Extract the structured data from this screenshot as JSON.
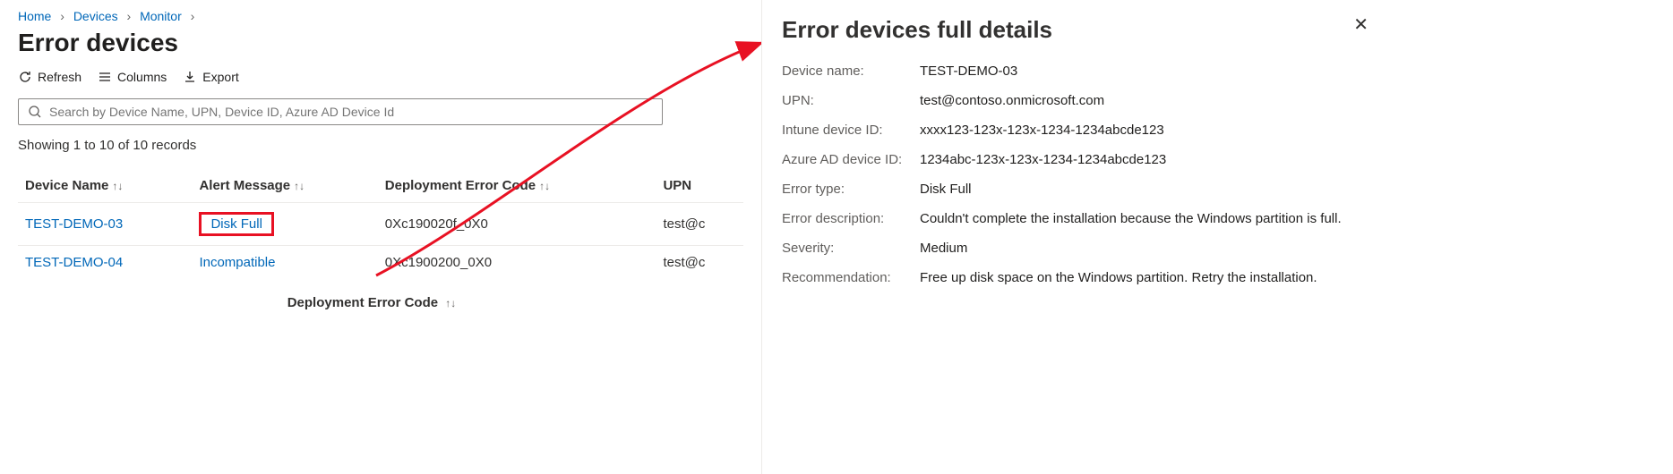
{
  "breadcrumb": {
    "home": "Home",
    "devices": "Devices",
    "monitor": "Monitor"
  },
  "page_title": "Error devices",
  "toolbar": {
    "refresh": "Refresh",
    "columns": "Columns",
    "export": "Export"
  },
  "search": {
    "placeholder": "Search by Device Name, UPN, Device ID, Azure AD Device Id"
  },
  "records_line": "Showing 1 to 10 of 10 records",
  "columns": {
    "device_name": "Device Name",
    "alert_message": "Alert Message",
    "deployment_error_code": "Deployment Error Code",
    "upn": "UPN"
  },
  "rows": [
    {
      "device_name": "TEST-DEMO-03",
      "alert_message": "Disk Full",
      "deployment_error_code": "0Xc190020f_0X0",
      "upn": "test@c"
    },
    {
      "device_name": "TEST-DEMO-04",
      "alert_message": "Incompatible",
      "deployment_error_code": "0Xc1900200_0X0",
      "upn": "test@c"
    }
  ],
  "footer_col_label": "Deployment Error Code",
  "flyout": {
    "title": "Error devices full details",
    "labels": {
      "device_name": "Device name:",
      "upn": "UPN:",
      "intune_id": "Intune device ID:",
      "aad_id": "Azure AD device ID:",
      "error_type": "Error type:",
      "error_description": "Error description:",
      "severity": "Severity:",
      "recommendation": "Recommendation:"
    },
    "values": {
      "device_name": "TEST-DEMO-03",
      "upn": "test@contoso.onmicrosoft.com",
      "intune_id": "xxxx123-123x-123x-1234-1234abcde123",
      "aad_id": "1234abc-123x-123x-1234-1234abcde123",
      "error_type": "Disk Full",
      "error_description": "Couldn't complete the installation because the Windows partition is full.",
      "severity": "Medium",
      "recommendation": "Free up disk space on the Windows partition. Retry the installation."
    }
  }
}
